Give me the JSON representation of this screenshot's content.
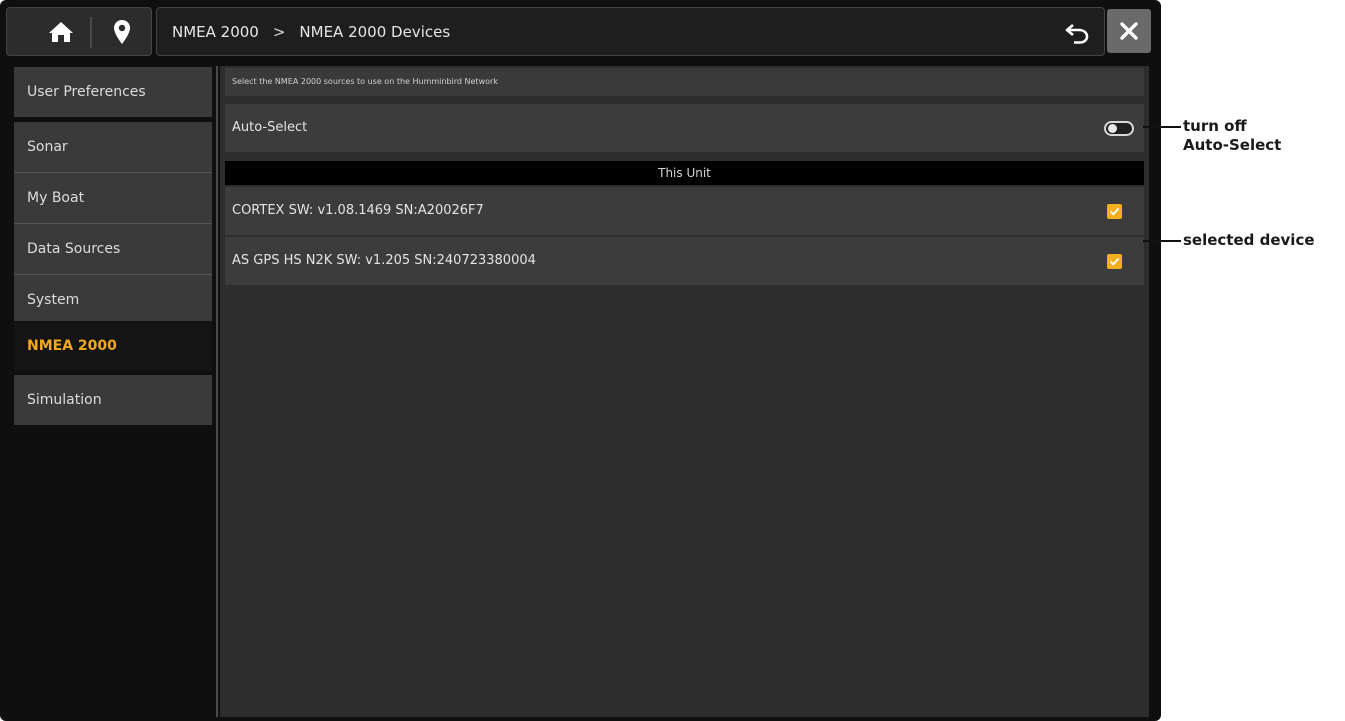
{
  "breadcrumb": {
    "level1": "NMEA 2000",
    "separator": ">",
    "level2": "NMEA 2000 Devices"
  },
  "sidebar": {
    "items": [
      {
        "label": "User Preferences",
        "active": false
      },
      {
        "label": "Sonar",
        "active": false
      },
      {
        "label": "My Boat",
        "active": false
      },
      {
        "label": "Data Sources",
        "active": false
      },
      {
        "label": "System",
        "active": false
      },
      {
        "label": "NMEA 2000",
        "active": true
      },
      {
        "label": "Simulation",
        "active": false
      }
    ]
  },
  "main": {
    "hint": "Select the NMEA 2000 sources to use on the Humminbird Network",
    "auto_select": {
      "label": "Auto-Select",
      "state": "off"
    },
    "section_header": "This Unit",
    "devices": [
      {
        "label": "CORTEX SW: v1.08.1469 SN:A20026F7",
        "checked": true
      },
      {
        "label": "AS GPS HS N2K SW: v1.205 SN:240723380004",
        "checked": true
      }
    ]
  },
  "callouts": {
    "auto_select_line1": "turn off",
    "auto_select_line2": "Auto-Select",
    "selected_device": "selected device"
  },
  "colors": {
    "accent": "#f2a81d",
    "checkbox": "#f2b01e",
    "background": "#0f0f0f"
  },
  "icons": [
    "home-icon",
    "map-pin-icon",
    "back-icon",
    "close-icon",
    "checkmark-icon"
  ]
}
